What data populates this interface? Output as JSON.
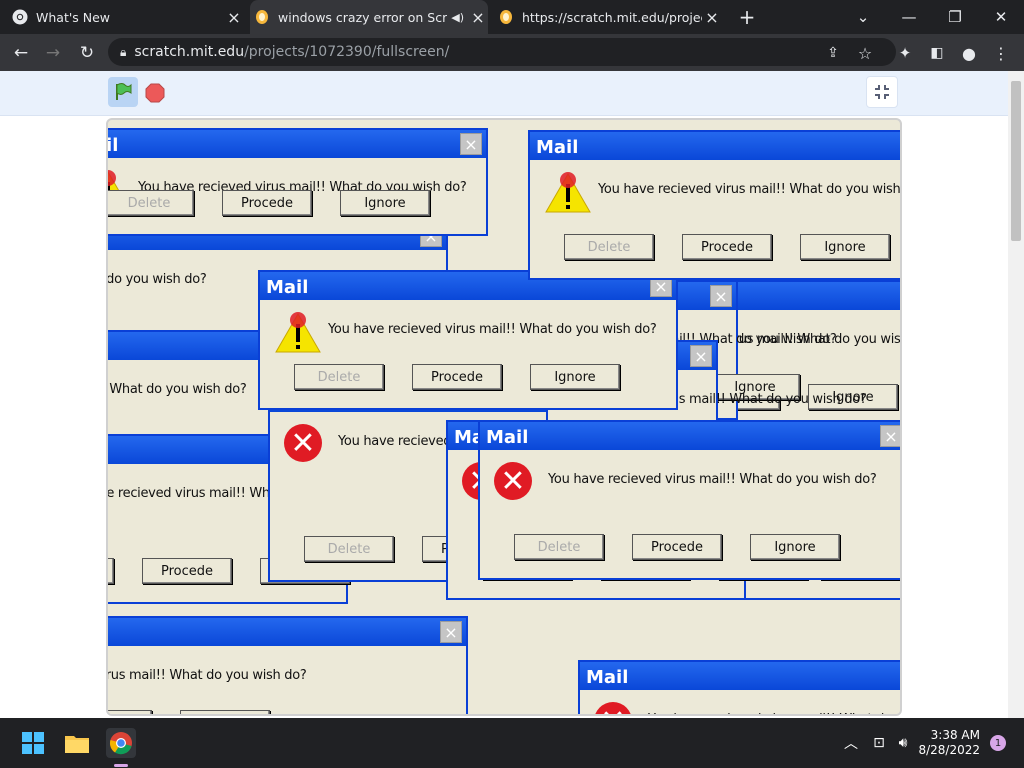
{
  "browser": {
    "tabs": [
      {
        "title": "What's New",
        "active": false
      },
      {
        "title": "windows crazy error on Scrat",
        "active": true
      },
      {
        "title": "https://scratch.mit.edu/projects/",
        "active": false
      }
    ],
    "new_tab": "+",
    "url_host": "scratch.mit.edu",
    "url_path": "/projects/1072390/fullscreen/"
  },
  "dialog": {
    "title": "Mail",
    "message": "You have recieved virus mail!! What do you wish do?",
    "buttons": [
      "Delete",
      "Procede",
      "Ignore"
    ],
    "close": "×"
  },
  "taskbar": {
    "time": "3:38 AM",
    "date": "8/28/2022",
    "notification_count": "1"
  },
  "colors": {
    "titlebar": "#0a47d8",
    "dialog_bg": "#ece9d8",
    "error_red": "#e01b24",
    "warning_yellow": "#f5e400"
  }
}
